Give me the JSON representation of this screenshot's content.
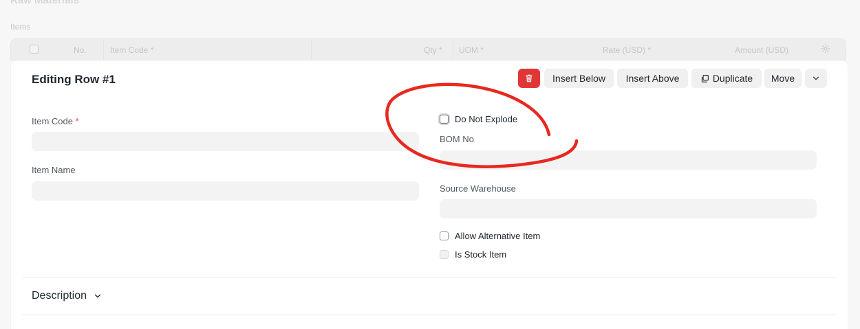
{
  "background": {
    "section_heading": "Raw Materials",
    "items_label": "Items",
    "table_columns": {
      "no": "No.",
      "item_code": "Item Code *",
      "qty": "Qty *",
      "uom": "UOM *",
      "rate": "Rate (USD) *",
      "amount": "Amount (USD)"
    },
    "settings_icon": "gear-icon"
  },
  "editor": {
    "title": "Editing Row #1",
    "toolbar": {
      "delete_icon": "trash-icon",
      "insert_below": "Insert Below",
      "insert_above": "Insert Above",
      "duplicate": "Duplicate",
      "duplicate_icon": "copy-icon",
      "move": "Move",
      "more_icon": "chevron-down-icon"
    },
    "left_fields": {
      "item_code_label": "Item Code",
      "item_code_required": "*",
      "item_code_value": "",
      "item_name_label": "Item Name",
      "item_name_value": ""
    },
    "right_fields": {
      "do_not_explode": "Do Not Explode",
      "bom_no_label": "BOM No",
      "bom_no_value": "",
      "source_warehouse_label": "Source Warehouse",
      "source_warehouse_value": "",
      "allow_alternative_item": "Allow Alternative Item",
      "is_stock_item": "Is Stock Item"
    },
    "description_section": "Description"
  },
  "colors": {
    "danger": "#e03636",
    "annotation": "#e8281f",
    "input_bg": "#f3f3f3"
  }
}
